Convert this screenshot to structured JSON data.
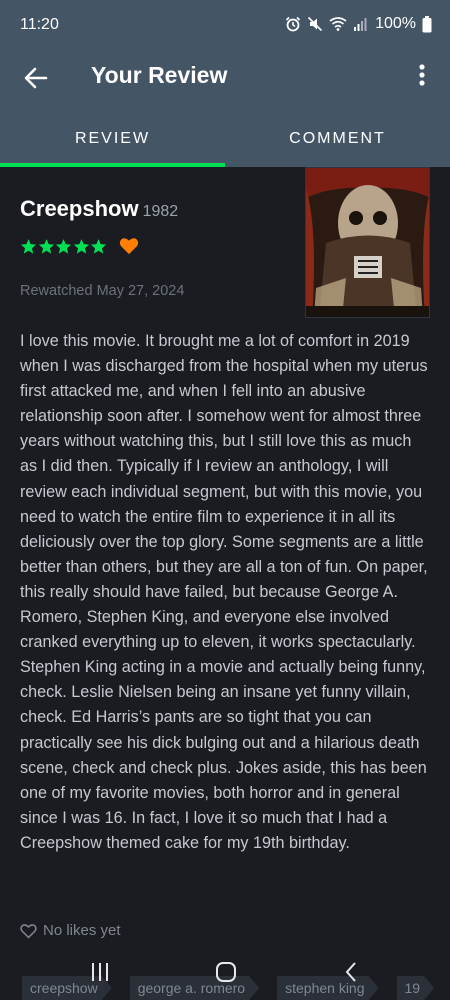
{
  "status": {
    "time": "11:20",
    "battery": "100%"
  },
  "appbar": {
    "title": "Your Review",
    "back_icon": "back-arrow-icon",
    "more_icon": "more-vertical-icon"
  },
  "tabs": [
    {
      "label": "REVIEW",
      "active": true
    },
    {
      "label": "COMMENT",
      "active": false
    }
  ],
  "colors": {
    "bar": "#445566",
    "background": "#1b1c22",
    "accent_green": "#00e054",
    "heart_orange": "#ff8000"
  },
  "film": {
    "title": "Creepshow",
    "year": "1982",
    "rating_stars": 5,
    "liked": true
  },
  "watched": "Rewatched May 27, 2024",
  "review": "I love this movie. It brought me a lot of comfort in 2019 when I was discharged from the hospital when my uterus first attacked me, and when I fell into an abusive relationship soon after. I somehow went for almost three years without watching this, but I still love this as much as I did then. Typically if I review an anthology, I will review each individual segment, but with this movie, you need to watch the entire film to experience it in all its deliciously over the top glory. Some segments are a little better than others, but they are all a ton of fun. On paper, this really should have failed, but because George A. Romero, Stephen King, and everyone else involved cranked everything up to eleven, it works spectacularly. Stephen King acting in a movie and actually being funny, check. Leslie Nielsen being an insane yet funny villain, check. Ed Harris’s pants are so tight that you can practically see his dick bulging out and a hilarious death scene, check and check plus. Jokes aside, this has been one of my favorite movies, both horror and in general since I was 16. In fact, I love it so much that I had a Creepshow themed cake for my 19th birthday.",
  "likes": {
    "text": "No likes yet",
    "icon": "heart-outline-icon"
  },
  "tags": [
    "creepshow",
    "george a. romero",
    "stephen king",
    "19"
  ],
  "navbar": {
    "recent_icon": "recent-apps-icon",
    "home_icon": "home-icon",
    "back_icon": "nav-back-icon"
  }
}
